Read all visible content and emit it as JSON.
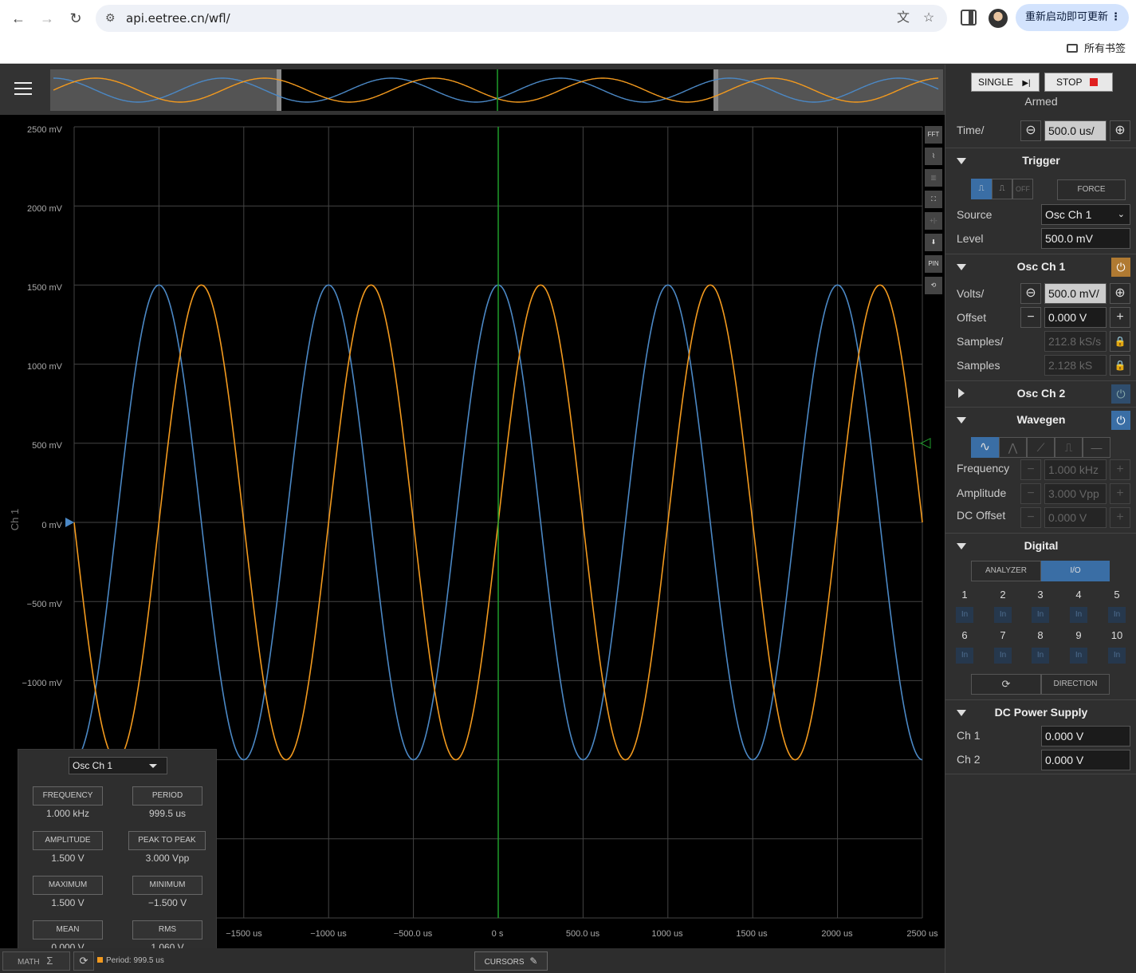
{
  "browser": {
    "url": "api.eetree.cn/wfl/",
    "update_button": "重新启动即可更新",
    "bookmarks_label": "所有书签"
  },
  "scope": {
    "y_axis": {
      "labels": [
        "2500 mV",
        "2000 mV",
        "1500 mV",
        "1000 mV",
        "500 mV",
        "0 mV",
        "−500 mV",
        "−1000 mV"
      ],
      "channel_label": "Ch 1"
    },
    "x_axis": {
      "labels": [
        "−1500 us",
        "−1000 us",
        "−500.0 us",
        "0 s",
        "500.0 us",
        "1000 us",
        "1500 us",
        "2000 us",
        "2500 us"
      ]
    },
    "tools": [
      "FFT",
      "⌇",
      "▥",
      "⛶",
      "+|-",
      "⬇",
      "PIN",
      "⟲"
    ]
  },
  "chart_data": {
    "type": "line",
    "xlabel": "",
    "ylabel": "Ch 1",
    "xlim": [
      -2500,
      2500
    ],
    "ylim": [
      -2500,
      2500
    ],
    "series": [
      {
        "color": "#4b88c5",
        "amplitude": 1500,
        "frequency_khz": 1.0,
        "phase_deg": 90
      },
      {
        "color": "#f39a1e",
        "amplitude": 1500,
        "frequency_khz": 1.0,
        "phase_deg": 0
      }
    ]
  },
  "measurements": {
    "source": "Osc Ch 1",
    "items": [
      {
        "label": "FREQUENCY",
        "value": "1.000 kHz"
      },
      {
        "label": "PERIOD",
        "value": "999.5 us"
      },
      {
        "label": "AMPLITUDE",
        "value": "1.500 V"
      },
      {
        "label": "PEAK TO PEAK",
        "value": "3.000 Vpp"
      },
      {
        "label": "MAXIMUM",
        "value": "1.500 V"
      },
      {
        "label": "MINIMUM",
        "value": "−1.500 V"
      },
      {
        "label": "MEAN",
        "value": "0.000 V"
      },
      {
        "label": "RMS",
        "value": "1.060 V"
      }
    ]
  },
  "bottom": {
    "math_label": "MATH",
    "period_text": "Period: 999.5 us",
    "cursors_label": "CURSORS"
  },
  "side": {
    "single_label": "SINGLE",
    "stop_label": "STOP",
    "status": "Armed",
    "time_label": "Time/",
    "time_value": "500.0 us/",
    "trigger": {
      "title": "Trigger",
      "off_label": "OFF",
      "force_label": "FORCE",
      "source_label": "Source",
      "source_value": "Osc Ch 1",
      "level_label": "Level",
      "level_value": "500.0 mV"
    },
    "osc_ch1": {
      "title": "Osc Ch 1",
      "volts_label": "Volts/",
      "volts_value": "500.0 mV/",
      "offset_label": "Offset",
      "offset_value": "0.000 V",
      "samples_per_label": "Samples/",
      "samples_per_value": "212.8 kS/s",
      "samples_label": "Samples",
      "samples_value": "2.128 kS"
    },
    "osc_ch2": {
      "title": "Osc Ch 2"
    },
    "wavegen": {
      "title": "Wavegen",
      "frequency_label": "Frequency",
      "frequency_value": "1.000 kHz",
      "amplitude_label": "Amplitude",
      "amplitude_value": "3.000 Vpp",
      "dc_offset_label": "DC Offset",
      "dc_offset_value": "0.000 V"
    },
    "digital": {
      "title": "Digital",
      "analyzer_label": "ANALYZER",
      "io_label": "I/O",
      "pins": [
        "1",
        "2",
        "3",
        "4",
        "5",
        "6",
        "7",
        "8",
        "9",
        "10"
      ],
      "pin_state": "In",
      "direction_label": "DIRECTION"
    },
    "dc_power": {
      "title": "DC Power Supply",
      "ch1_label": "Ch 1",
      "ch1_value": "0.000 V",
      "ch2_label": "Ch 2",
      "ch2_value": "0.000 V"
    }
  },
  "colors": {
    "ch1": "#4b88c5",
    "wavegen": "#f39a1e",
    "trigger_line": "#1f9d2b",
    "accent_blue": "#3a6ea5",
    "ch1_power": "#b07a32"
  }
}
